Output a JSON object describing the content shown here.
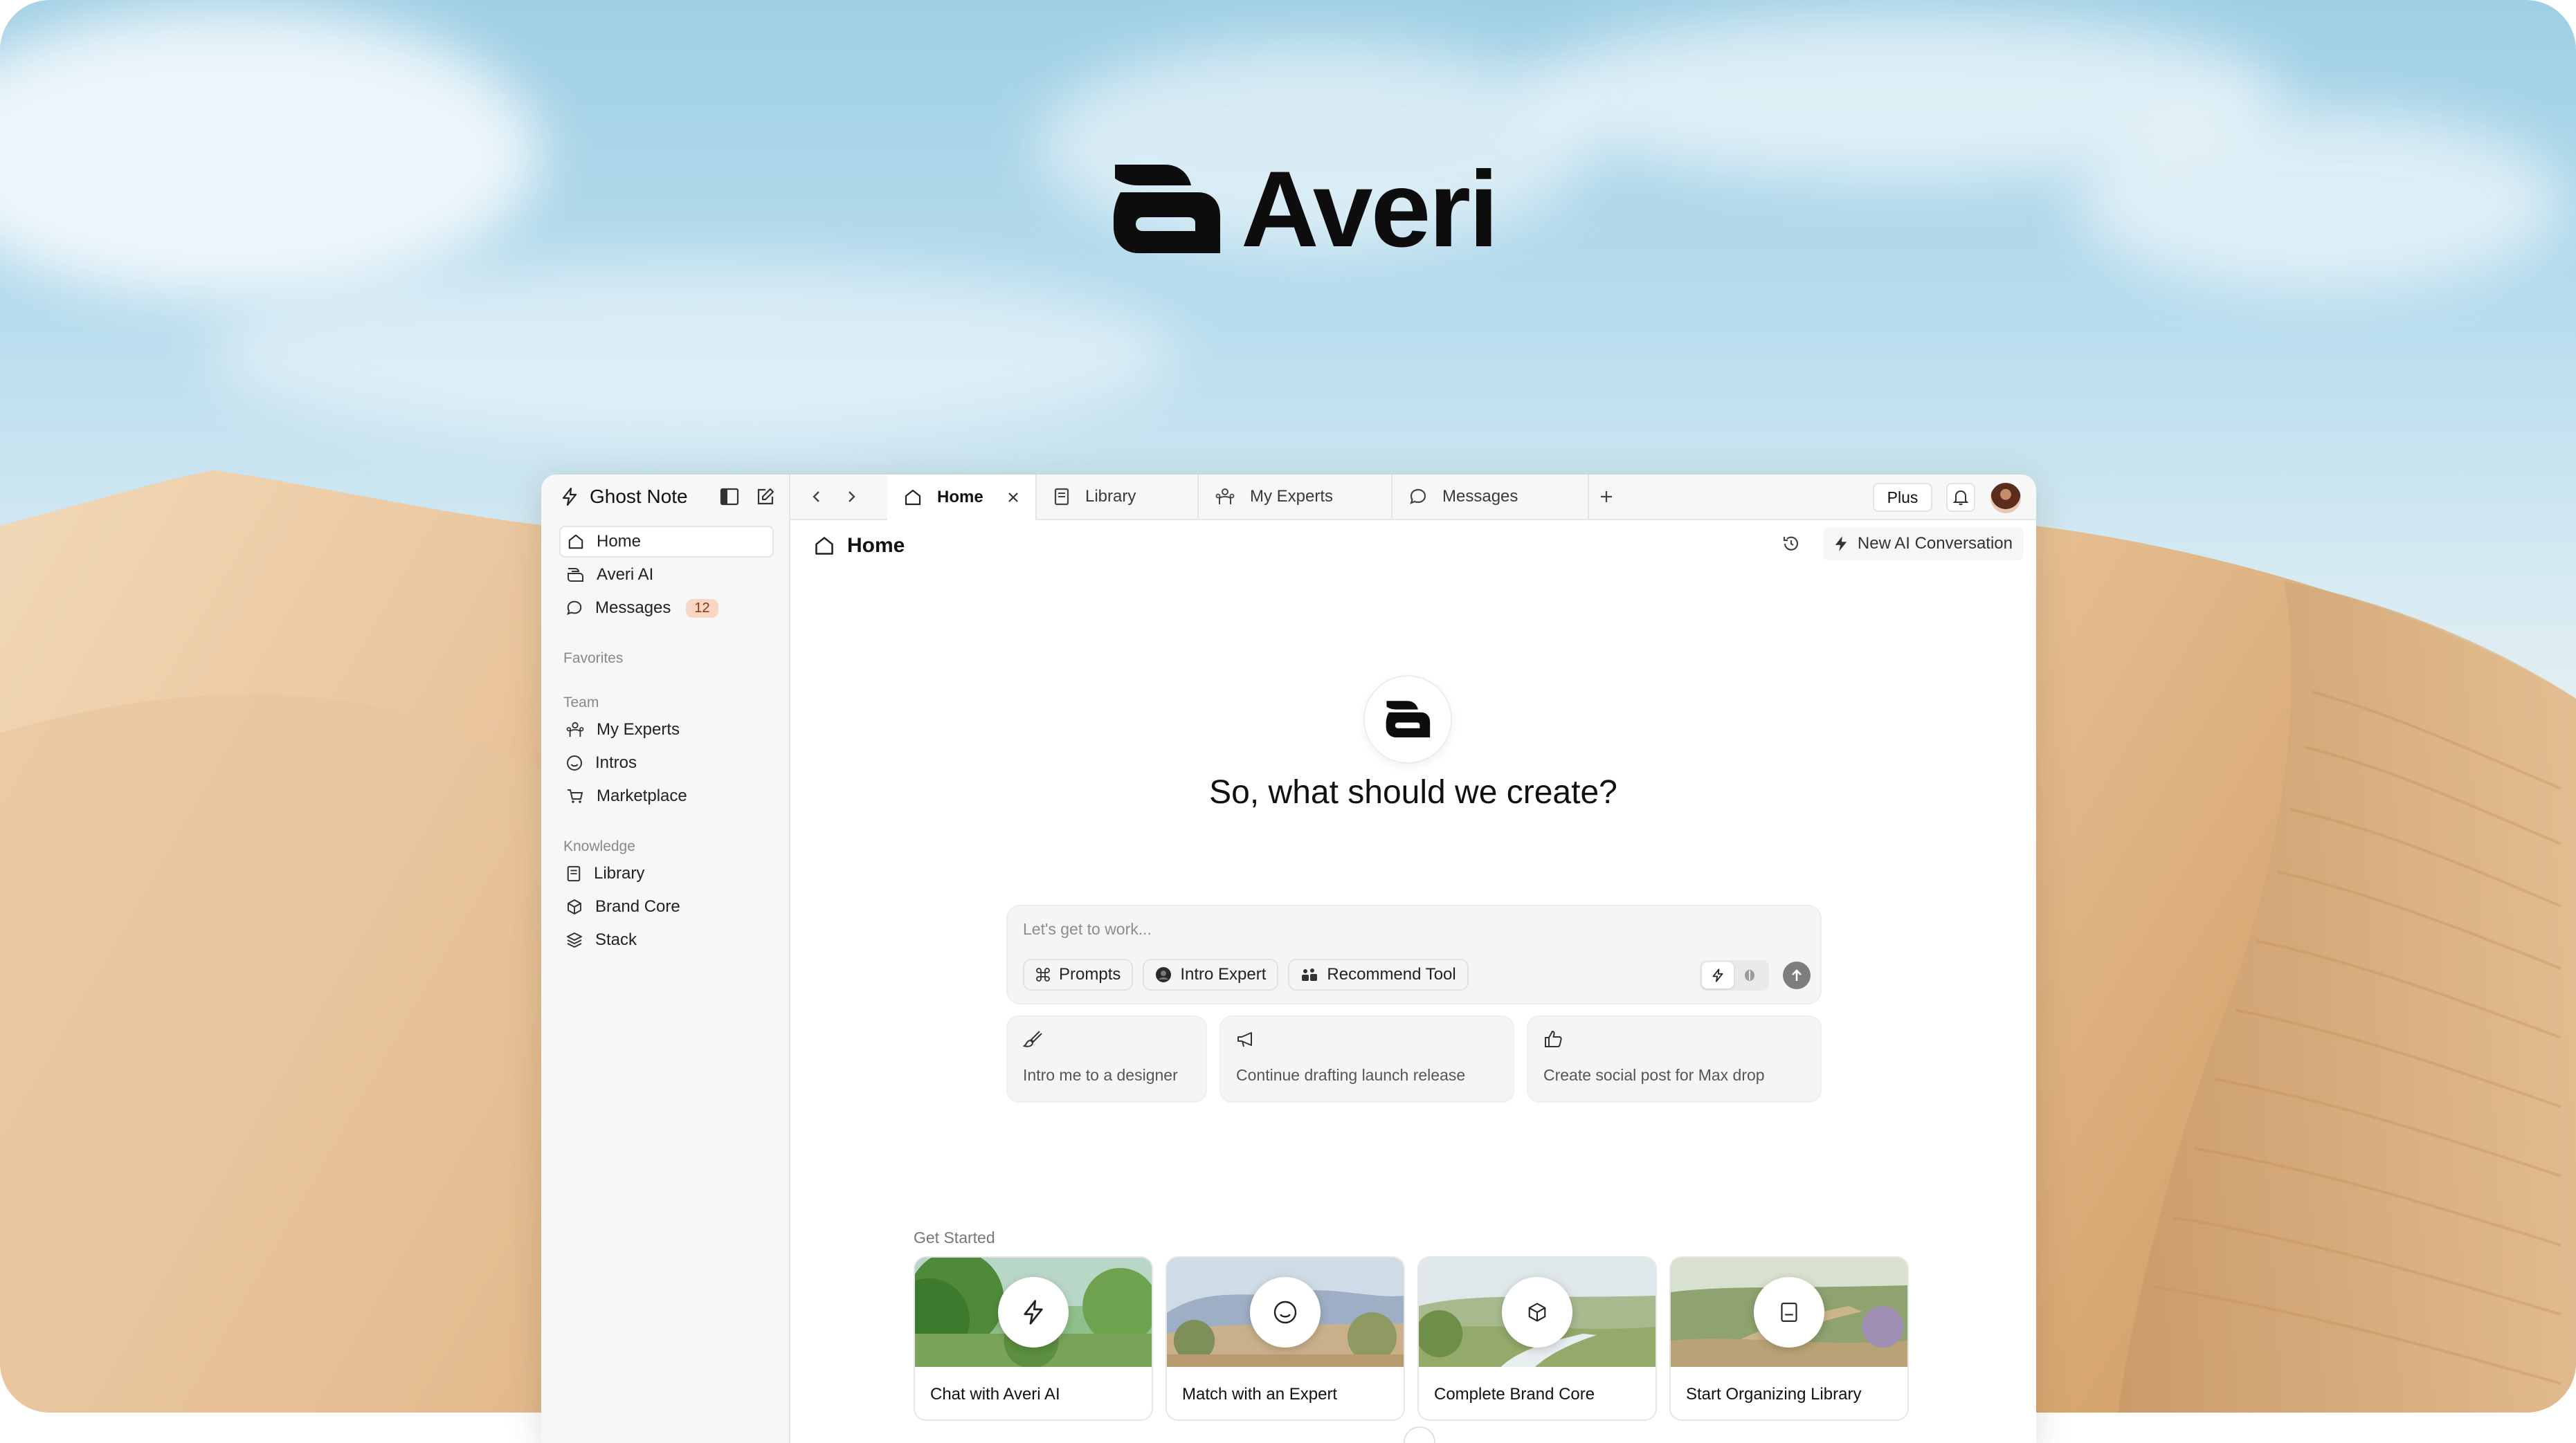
{
  "brand": {
    "name": "Averi"
  },
  "workspace": {
    "name": "Ghost Note"
  },
  "tabs": [
    {
      "label": "Home",
      "icon": "home-icon",
      "active": true
    },
    {
      "label": "Library",
      "icon": "book-icon",
      "active": false
    },
    {
      "label": "My Experts",
      "icon": "experts-icon",
      "active": false
    },
    {
      "label": "Messages",
      "icon": "chat-bubble-icon",
      "active": false
    }
  ],
  "topbar": {
    "plan_label": "Plus"
  },
  "sidebar": {
    "items": [
      {
        "label": "Home",
        "icon": "home-icon"
      },
      {
        "label": "Averi AI",
        "icon": "averi-icon"
      },
      {
        "label": "Messages",
        "icon": "chat-bubble-icon",
        "badge": "12"
      }
    ],
    "favorites_label": "Favorites",
    "team_label": "Team",
    "team_items": [
      {
        "label": "My Experts",
        "icon": "experts-icon"
      },
      {
        "label": "Intros",
        "icon": "smile-icon"
      },
      {
        "label": "Marketplace",
        "icon": "cart-icon"
      }
    ],
    "knowledge_label": "Knowledge",
    "knowledge_items": [
      {
        "label": "Library",
        "icon": "book-icon"
      },
      {
        "label": "Brand Core",
        "icon": "cube-icon"
      },
      {
        "label": "Stack",
        "icon": "layers-icon"
      }
    ]
  },
  "main": {
    "title": "Home",
    "new_conversation_label": "New AI Conversation",
    "hero_title": "So, what should we create?",
    "composer": {
      "placeholder": "Let's get to work...",
      "chips": [
        {
          "label": "Prompts",
          "icon": "command-icon"
        },
        {
          "label": "Intro Expert",
          "icon": "expert-avatar-icon"
        },
        {
          "label": "Recommend Tool",
          "icon": "tools-icon"
        }
      ]
    },
    "suggestions": [
      {
        "label": "Intro me to a designer",
        "icon": "paintbrush-icon"
      },
      {
        "label": "Continue drafting launch release",
        "icon": "megaphone-icon"
      },
      {
        "label": "Create social post for Max drop",
        "icon": "thumbs-up-icon"
      }
    ],
    "get_started_label": "Get Started",
    "cards": [
      {
        "label": "Chat with Averi AI",
        "icon": "lightning-icon"
      },
      {
        "label": "Match with an Expert",
        "icon": "smile-icon"
      },
      {
        "label": "Complete Brand Core",
        "icon": "cube-icon"
      },
      {
        "label": "Start Organizing Library",
        "icon": "book-icon"
      }
    ]
  }
}
